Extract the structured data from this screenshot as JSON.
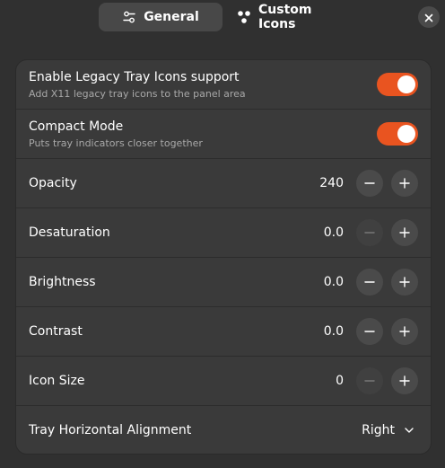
{
  "tabs": [
    {
      "label": "General",
      "icon": "settings-sliders-icon",
      "active": true
    },
    {
      "label": "Custom Icons",
      "icon": "custom-icons-icon",
      "active": false
    }
  ],
  "close_icon": "close-icon",
  "accent_color": "#e95420",
  "toggles": [
    {
      "title": "Enable Legacy Tray Icons support",
      "subtitle": "Add X11 legacy tray icons to the panel area",
      "on": true
    },
    {
      "title": "Compact Mode",
      "subtitle": "Puts tray indicators closer together",
      "on": true
    }
  ],
  "spinners": [
    {
      "title": "Opacity",
      "value": "240",
      "minus_enabled": true
    },
    {
      "title": "Desaturation",
      "value": "0.0",
      "minus_enabled": false
    },
    {
      "title": "Brightness",
      "value": "0.0",
      "minus_enabled": true
    },
    {
      "title": "Contrast",
      "value": "0.0",
      "minus_enabled": true
    },
    {
      "title": "Icon Size",
      "value": "0",
      "minus_enabled": false
    }
  ],
  "alignment": {
    "title": "Tray Horizontal Alignment",
    "value": "Right"
  }
}
